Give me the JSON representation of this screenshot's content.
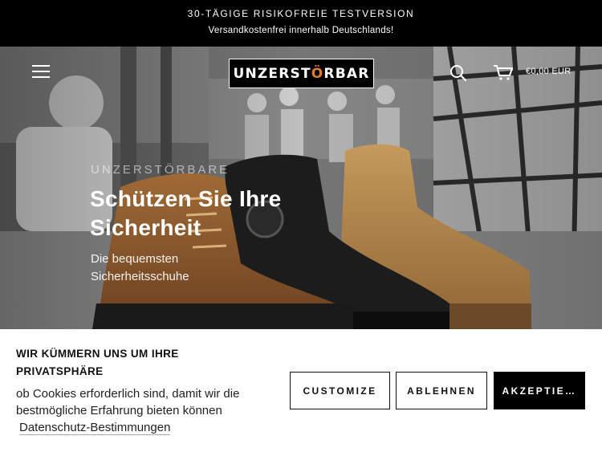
{
  "announcement": {
    "headline": "30-TÄGIGE RISIKOFREIE TESTVERSION",
    "subline": "Versandkostenfrei innerhalb Deutschlands!"
  },
  "header": {
    "menu_icon": "hamburger-menu-icon",
    "logo_text_main": "UNZERST",
    "logo_text_accent": "Ö",
    "logo_text_end": "RBAR",
    "search_icon": "search-icon",
    "cart_icon": "cart-icon",
    "cart_total": "€0,00 EUR"
  },
  "hero": {
    "eyebrow": "UNZERSTÖRBARE",
    "title": "Schützen Sie Ihre Sicherheit",
    "subtitle": "Die bequemsten Sicherheitsschuhe"
  },
  "cookie_banner": {
    "heading": "WIR KÜMMERN UNS UM IHRE PRIVATSPHÄRE",
    "text": "ob Cookies erforderlich sind, damit wir die bestmögliche Erfahrung bieten können",
    "link": "Datenschutz-Bestimmungen",
    "customize_label": "CUSTOMIZE",
    "reject_label": "ABLEHNEN",
    "accept_label": "AKZEPTIE…"
  },
  "colors": {
    "announcement_bg": "#000000",
    "logo_accent": "#e07a2a",
    "accept_bg": "#000000"
  }
}
